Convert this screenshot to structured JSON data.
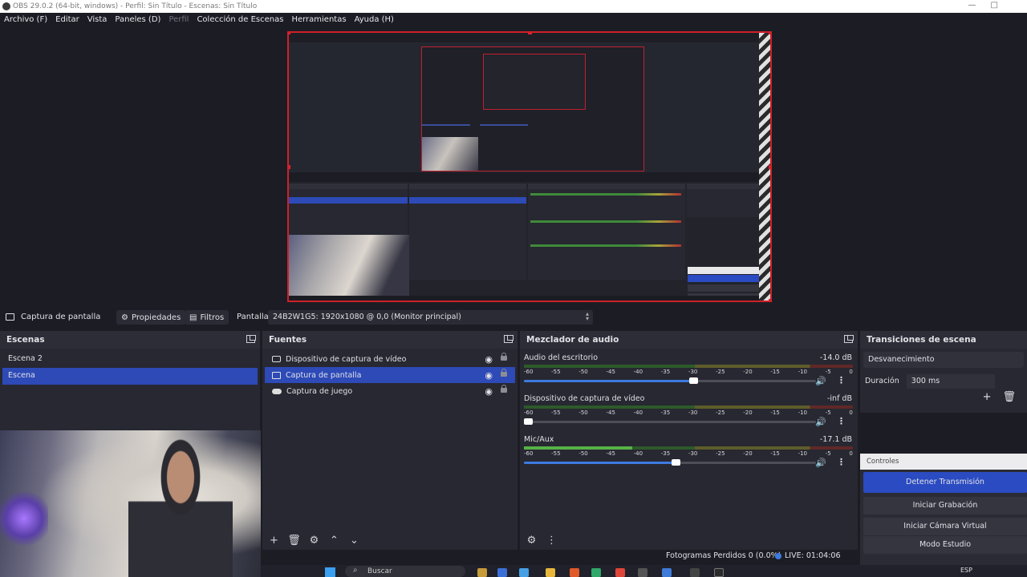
{
  "window": {
    "title": "OBS 29.0.2 (64-bit, windows) - Perfil: Sin Título - Escenas: Sin Título"
  },
  "menu": {
    "items": [
      "Archivo (F)",
      "Editar",
      "Vista",
      "Paneles (D)",
      "Perfil",
      "Colección de Escenas",
      "Herramientas",
      "Ayuda (H)"
    ],
    "disabled_index": 4
  },
  "source_toolbar": {
    "selected_source": "Captura de pantalla",
    "properties_label": "Propiedades",
    "filters_label": "Filtros",
    "display_label": "Pantalla",
    "display_value": "24B2W1G5: 1920x1080 @ 0,0 (Monitor principal)"
  },
  "scenes": {
    "title": "Escenas",
    "items": [
      "Escena 2",
      "Escena"
    ],
    "selected_index": 1
  },
  "sources": {
    "title": "Fuentes",
    "items": [
      {
        "label": "Dispositivo de captura de vídeo",
        "icon": "camera-icon"
      },
      {
        "label": "Captura de pantalla",
        "icon": "monitor-icon"
      },
      {
        "label": "Captura de juego",
        "icon": "gamepad-icon"
      }
    ],
    "selected_index": 1
  },
  "mixer": {
    "title": "Mezclador de audio",
    "ticks": [
      "-60",
      "-55",
      "-50",
      "-45",
      "-40",
      "-35",
      "-30",
      "-25",
      "-20",
      "-15",
      "-10",
      "-5",
      "0"
    ],
    "channels": [
      {
        "name": "Audio del escritorio",
        "db": "-14.0 dB",
        "level": 0,
        "volume": 0.58
      },
      {
        "name": "Dispositivo de captura de vídeo",
        "db": "-inf dB",
        "level": 0,
        "volume": 0.0
      },
      {
        "name": "Mic/Aux",
        "db": "-17.1 dB",
        "level": 0.33,
        "volume": 0.52
      }
    ]
  },
  "transitions": {
    "title": "Transiciones de escena",
    "selected": "Desvanecimiento",
    "duration_label": "Duración",
    "duration_value": "300 ms"
  },
  "controls": {
    "title": "Controles",
    "buttons": [
      "Detener Transmisión",
      "Iniciar Grabación",
      "Iniciar Cámara Virtual",
      "Modo Estudio"
    ]
  },
  "status": {
    "dropped_frames": "Fotogramas Perdidos 0 (0.0%)",
    "live": "LIVE: 01:04:06"
  },
  "taskbar": {
    "search_placeholder": "Buscar",
    "language": "ESP"
  },
  "colors": {
    "accent": "#2d4ab7",
    "preview_border": "#d0202a",
    "background": "#1c1d24"
  }
}
